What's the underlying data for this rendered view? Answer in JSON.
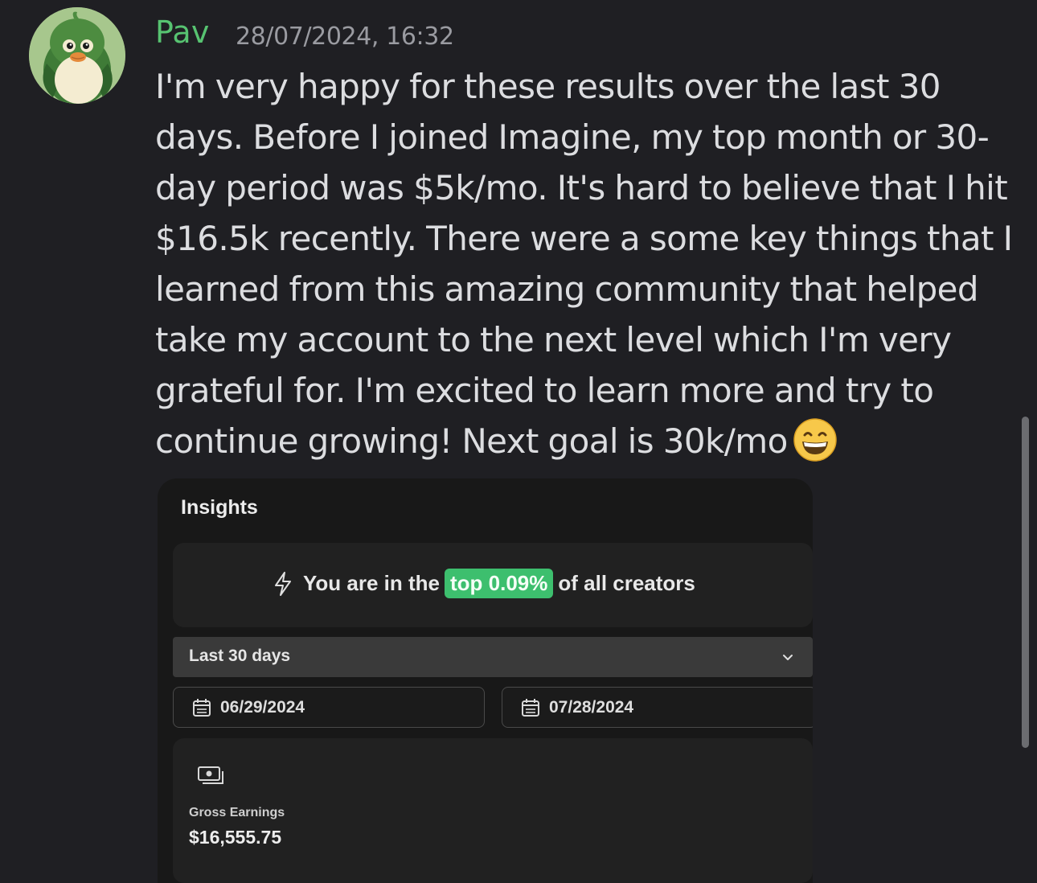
{
  "message": {
    "author": "Pav",
    "author_color": "#57c371",
    "timestamp": "28/07/2024, 16:32",
    "avatar_icon": "green-penguin-avatar",
    "lines": [
      "I'm very happy for these results over the last 30",
      "days. Before I joined Imagine, my top month or 30-",
      "day period was $5k/mo. It's hard to believe that I hit",
      "$16.5k recently. There were a some key things that I",
      "learned from this amazing community that helped",
      "take my account to the next level which I'm very",
      "grateful for. I'm excited to learn more and try to",
      "continue growing! Next goal is 30k/mo"
    ],
    "emoji": "grinning-face-emoji"
  },
  "insights": {
    "title": "Insights",
    "rank_prefix": "You are in the",
    "rank_highlight": "top 0.09%",
    "rank_suffix": "of all creators",
    "highlight_color": "#3dbf6e",
    "period": "Last 30 days",
    "start_date": "06/29/2024",
    "end_date": "07/28/2024",
    "earnings_label": "Gross Earnings",
    "earnings_value": "$16,555.75"
  }
}
